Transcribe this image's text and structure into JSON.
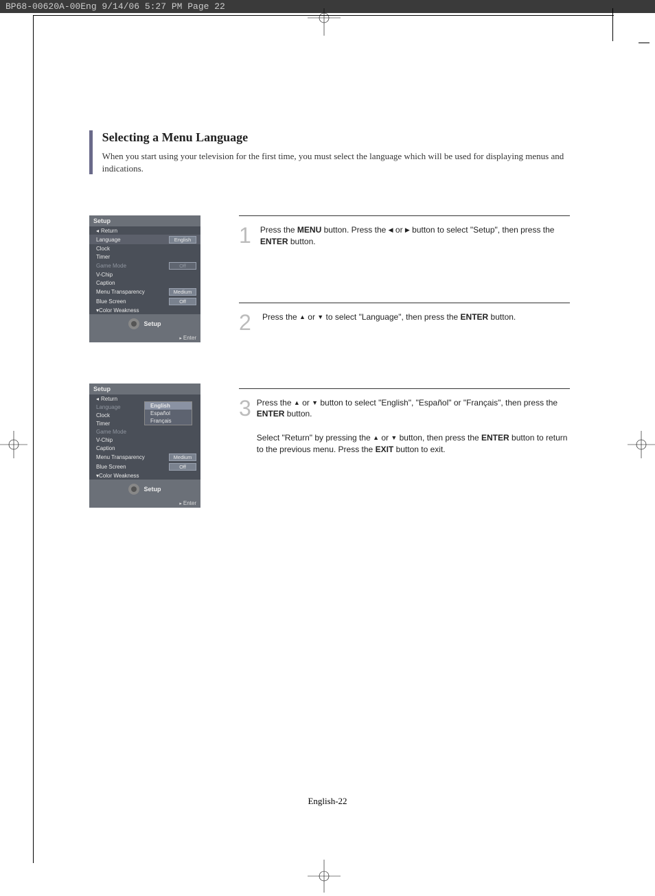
{
  "print_header": "BP68-00620A-00Eng  9/14/06  5:27 PM  Page 22",
  "section": {
    "title": "Selecting a Menu Language",
    "intro": "When you start using your television for the first time, you must select the language which will be used for displaying menus and indications."
  },
  "steps": {
    "s1_num": "1",
    "s1_a": "Press the ",
    "s1_menu": "MENU",
    "s1_b": " button. Press the ",
    "s1_c": " or ",
    "s1_d": " button to select \"Setup\", then press the ",
    "s1_enter": "ENTER",
    "s1_e": " button.",
    "s2_num": "2",
    "s2_a": "Press the ",
    "s2_b": " or ",
    "s2_c": " to select \"Language\", then press the ",
    "s2_enter": "ENTER",
    "s2_d": " button.",
    "s3_num": "3",
    "s3_a": "Press the ",
    "s3_b": " or ",
    "s3_c": " button to select \"English\", \"Español\" or \"Français\", then press the ",
    "s3_enter": "ENTER",
    "s3_d": " button.",
    "s3_ret_a": "Select \"Return\" by pressing the ",
    "s3_ret_b": " or ",
    "s3_ret_c": " button, then press the ",
    "s3_ret_enter": "ENTER",
    "s3_ret_d": " button to return to the previous menu. Press the ",
    "s3_exit": "EXIT",
    "s3_ret_e": " button to exit."
  },
  "osd": {
    "title": "Setup",
    "return": "Return",
    "language": "Language",
    "english": "English",
    "espanol": "Español",
    "francais": "Français",
    "clock": "Clock",
    "timer": "Timer",
    "game_mode": "Game Mode",
    "game_off": "Off",
    "vchip": "V-Chip",
    "caption": "Caption",
    "menu_trans": "Menu Transparency",
    "medium": "Medium",
    "blue_screen": "Blue Screen",
    "blue_off": "Off",
    "color_weak": "Color Weakness",
    "label": "Setup",
    "enter": "Enter"
  },
  "footer": "English-22"
}
